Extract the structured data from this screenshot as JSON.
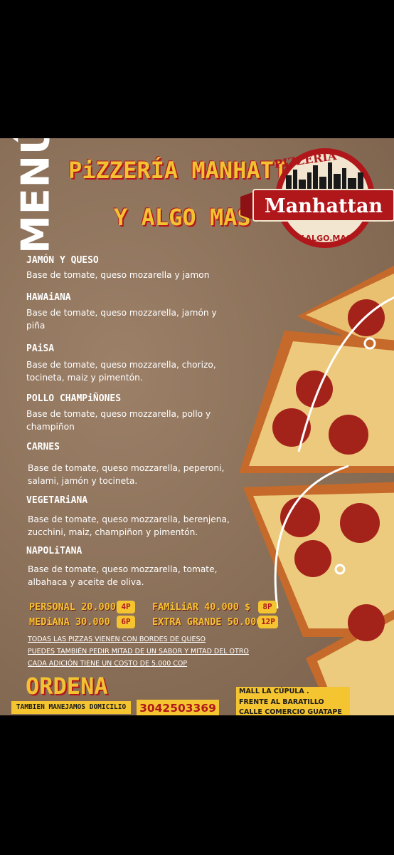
{
  "menu_word": "MENÚ",
  "title_line1": "PiZZERÍA MANHATTAN",
  "title_line2": "Y ALGO MAS",
  "logo": {
    "top": "PIZZERÍA",
    "name": "Manhattan",
    "bottom": "Y.ALGO.MAS",
    "colors": {
      "red": "#b0171b",
      "cream": "#f2e6d0"
    }
  },
  "items": [
    {
      "name": "JAMÓN Y QUESO",
      "desc": "Base de tomate, queso mozarella y jamon"
    },
    {
      "name": "HAWAiANA",
      "desc": "Base de tomate, queso mozzarella, jamón y piña"
    },
    {
      "name": "PAiSA",
      "desc": "Base de tomate, queso mozzarella, chorizo, tocineta, maiz y pimentón."
    },
    {
      "name": "POLLO CHAMPiÑONES",
      "desc": "Base de tomate, queso mozzarella, pollo y champiñon"
    },
    {
      "name": "CARNES",
      "desc": "Base de tomate, queso mozzarella, peperoni, salami, jamón y tocineta."
    },
    {
      "name": "VEGETARiANA",
      "desc": "Base de tomate, queso mozzarella, berenjena, zucchini, maiz, champiñon y pimentón."
    },
    {
      "name": "NAPOLiTANA",
      "desc": "Base de tomate, queso mozzarella, tomate, albahaca y aceite de oliva."
    }
  ],
  "prices": [
    {
      "label": "PERSONAL 20.000 $",
      "badge": "4P"
    },
    {
      "label": "MEDiANA 30.000 $",
      "badge": "6P"
    },
    {
      "label": "FAMiLiAR 40.000 $",
      "badge": "8P"
    },
    {
      "label": "EXTRA GRANDE 50.000 $",
      "badge": "12P"
    }
  ],
  "notes": [
    "TODAS LAS PIZZAS VIENEN CON BORDES DE QUESO",
    "PUEDES TAMBIÉN PEDIR MITAD DE UN SABOR Y MITAD DEL OTRO",
    "CADA ADICIÓN TIENE UN COSTO DE 5.000 COP"
  ],
  "ordena": "ORDENA",
  "domicilio": "TAMBIEN MANEJAMOS DOMICILIO",
  "phone": "3042503369",
  "address": [
    "MALL LA CÚPULA .",
    "FRENTE AL BARATILLO",
    "CALLE COMERCIO GUATAPE"
  ],
  "colors": {
    "accent_yellow": "#f5c531",
    "accent_red": "#b0171b",
    "kraft": "#8a6f58"
  }
}
